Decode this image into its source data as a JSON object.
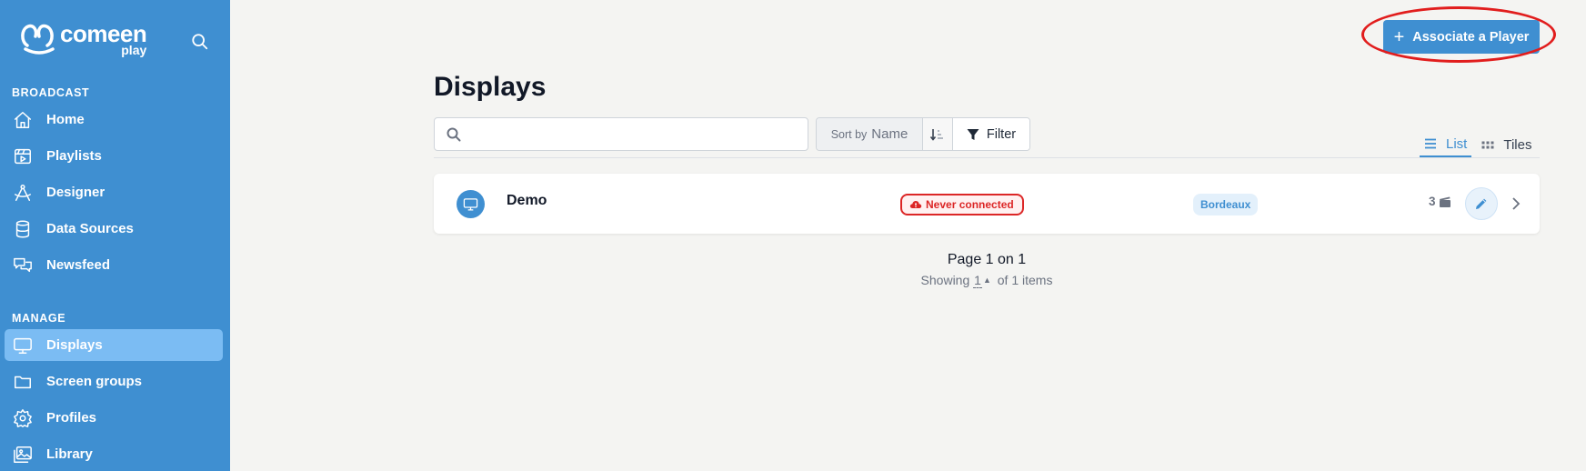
{
  "brand": {
    "name": "comeen",
    "product": "play"
  },
  "sidebar": {
    "sections": [
      {
        "title": "BROADCAST"
      },
      {
        "title": "MANAGE"
      }
    ],
    "items": [
      {
        "label": "Home",
        "icon": "home-icon"
      },
      {
        "label": "Playlists",
        "icon": "playlist-icon"
      },
      {
        "label": "Designer",
        "icon": "designer-icon"
      },
      {
        "label": "Data Sources",
        "icon": "database-icon"
      },
      {
        "label": "Newsfeed",
        "icon": "chat-icon"
      },
      {
        "label": "Displays",
        "icon": "monitor-icon",
        "active": true
      },
      {
        "label": "Screen groups",
        "icon": "folder-icon"
      },
      {
        "label": "Profiles",
        "icon": "gear-icon"
      },
      {
        "label": "Library",
        "icon": "images-icon"
      }
    ]
  },
  "header": {
    "associate_label": "Associate a Player",
    "associate_plus": "+"
  },
  "page": {
    "title": "Displays"
  },
  "toolbar": {
    "search_value": "",
    "sort_by": "Sort by",
    "sort_field": "Name",
    "filter_label": "Filter"
  },
  "views": {
    "list": "List",
    "tiles": "Tiles",
    "active": "list"
  },
  "displays": [
    {
      "name": "Demo",
      "status": "Never connected",
      "location": "Bordeaux",
      "count": "3"
    }
  ],
  "pagination": {
    "page_text": "Page 1 on 1",
    "showing_prefix": "Showing",
    "showing_num": "1",
    "showing_caret": "▲",
    "showing_suffix": "of 1 items"
  },
  "colors": {
    "primary": "#3f8fd1",
    "active_nav": "#7bbcf3",
    "danger": "#dc2626",
    "background": "#f4f4f2"
  }
}
